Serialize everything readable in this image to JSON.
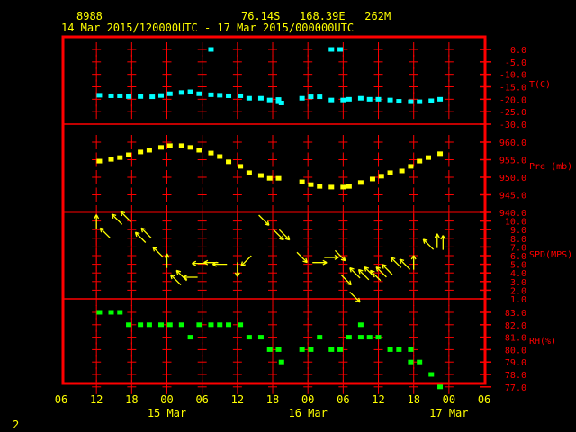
{
  "header": {
    "station": "8988",
    "location": "76.14S   168.39E   262M",
    "period": "14 Mar 2015/120000UTC - 17 Mar 2015/000000UTC",
    "page_number": "2"
  },
  "colors": {
    "frame": "#ff0000",
    "text": "#ffff00",
    "temperature": "#00ffff",
    "pressure": "#ffff00",
    "wind": "#ffff00",
    "rh": "#00ff00"
  },
  "chart_data": {
    "type": "scatter",
    "x_axis": {
      "range": [
        "14 Mar 06:00",
        "17 Mar 06:00"
      ],
      "tick_labels": [
        "06",
        "12",
        "18",
        "00",
        "06",
        "12",
        "18",
        "00",
        "06",
        "12",
        "18",
        "00",
        "06"
      ],
      "date_labels": [
        {
          "label": "15 Mar",
          "at": "15 Mar 00:00"
        },
        {
          "label": "16 Mar",
          "at": "16 Mar 00:00"
        },
        {
          "label": "17 Mar",
          "at": "17 Mar 00:00"
        }
      ]
    },
    "panels": [
      {
        "id": "temperature",
        "ylabel": "T(C)",
        "ylim": [
          -30,
          0
        ],
        "tick_labels": [
          "0.0",
          "-5.0",
          "-10.0",
          "-15.0",
          "-20.0",
          "-25.0",
          "-30.0"
        ],
        "points": [
          [
            "14 Mar 12:30",
            -18.4
          ],
          [
            "14 Mar 14:30",
            -18.6
          ],
          [
            "14 Mar 16:00",
            -18.6
          ],
          [
            "14 Mar 17:30",
            -18.9
          ],
          [
            "14 Mar 19:30",
            -18.9
          ],
          [
            "14 Mar 21:30",
            -19.0
          ],
          [
            "14 Mar 23:00",
            -18.5
          ],
          [
            "15 Mar 00:30",
            -17.8
          ],
          [
            "15 Mar 02:30",
            -17.3
          ],
          [
            "15 Mar 04:00",
            -17.0
          ],
          [
            "15 Mar 05:30",
            -17.8
          ],
          [
            "15 Mar 07:30",
            -18.2
          ],
          [
            "15 Mar 09:00",
            -18.4
          ],
          [
            "15 Mar 10:30",
            -18.6
          ],
          [
            "15 Mar 12:30",
            -18.6
          ],
          [
            "15 Mar 14:00",
            -19.6
          ],
          [
            "15 Mar 16:00",
            -19.6
          ],
          [
            "15 Mar 17:30",
            -20.3
          ],
          [
            "15 Mar 19:00",
            -20.1
          ],
          [
            "15 Mar 19:00",
            -21.0
          ],
          [
            "15 Mar 19:30",
            -21.5
          ],
          [
            "15 Mar 23:00",
            -19.6
          ],
          [
            "16 Mar 00:30",
            -19.0
          ],
          [
            "16 Mar 02:00",
            -19.0
          ],
          [
            "16 Mar 04:00",
            -20.3
          ],
          [
            "16 Mar 06:00",
            -20.3
          ],
          [
            "16 Mar 07:00",
            -20.0
          ],
          [
            "16 Mar 09:00",
            -19.6
          ],
          [
            "16 Mar 10:30",
            -20.0
          ],
          [
            "16 Mar 12:00",
            -20.0
          ],
          [
            "16 Mar 14:00",
            -20.3
          ],
          [
            "16 Mar 15:30",
            -20.8
          ],
          [
            "16 Mar 17:30",
            -21.0
          ],
          [
            "16 Mar 19:00",
            -21.0
          ],
          [
            "16 Mar 21:00",
            -20.6
          ],
          [
            "16 Mar 22:30",
            -20.0
          ],
          [
            "15 Mar 07:30",
            0.0
          ],
          [
            "16 Mar 04:00",
            0.0
          ],
          [
            "16 Mar 05:30",
            0.0
          ]
        ]
      },
      {
        "id": "pressure",
        "ylabel": "Pre (mb)",
        "ylim": [
          940,
          965
        ],
        "tick_labels": [
          "960.0",
          "955.0",
          "950.0",
          "945.0",
          "940.0"
        ],
        "points": [
          [
            "14 Mar 12:30",
            954.6
          ],
          [
            "14 Mar 14:30",
            955.1
          ],
          [
            "14 Mar 16:00",
            955.6
          ],
          [
            "14 Mar 17:30",
            956.4
          ],
          [
            "14 Mar 19:30",
            957.2
          ],
          [
            "14 Mar 21:00",
            957.7
          ],
          [
            "14 Mar 23:00",
            958.5
          ],
          [
            "15 Mar 00:30",
            959.0
          ],
          [
            "15 Mar 02:30",
            959.0
          ],
          [
            "15 Mar 04:00",
            958.5
          ],
          [
            "15 Mar 05:30",
            957.7
          ],
          [
            "15 Mar 07:30",
            956.9
          ],
          [
            "15 Mar 09:00",
            955.9
          ],
          [
            "15 Mar 10:30",
            954.4
          ],
          [
            "15 Mar 12:30",
            953.1
          ],
          [
            "15 Mar 14:00",
            951.3
          ],
          [
            "15 Mar 16:00",
            950.5
          ],
          [
            "15 Mar 17:30",
            949.7
          ],
          [
            "15 Mar 19:00",
            949.7
          ],
          [
            "15 Mar 23:00",
            948.7
          ],
          [
            "16 Mar 00:30",
            947.9
          ],
          [
            "16 Mar 02:00",
            947.4
          ],
          [
            "16 Mar 04:00",
            947.2
          ],
          [
            "16 Mar 06:00",
            947.2
          ],
          [
            "16 Mar 07:00",
            947.4
          ],
          [
            "16 Mar 09:00",
            948.5
          ],
          [
            "16 Mar 11:00",
            949.5
          ],
          [
            "16 Mar 12:30",
            950.3
          ],
          [
            "16 Mar 14:00",
            951.3
          ],
          [
            "16 Mar 16:00",
            951.8
          ],
          [
            "16 Mar 17:30",
            953.1
          ],
          [
            "16 Mar 19:00",
            954.6
          ],
          [
            "16 Mar 20:30",
            955.6
          ],
          [
            "16 Mar 22:30",
            956.7
          ]
        ]
      },
      {
        "id": "wind",
        "ylabel": "SPD(MPS)",
        "ylim": [
          1,
          10
        ],
        "tick_labels": [
          "10.0",
          "9.0",
          "8.0",
          "7.0",
          "6.0",
          "5.0",
          "4.0",
          "3.0",
          "2.0",
          "1.0"
        ],
        "points_note_fields": [
          "time",
          "speed",
          "direction_to_deg"
        ],
        "points": [
          [
            "14 Mar 12:00",
            9.9,
            0
          ],
          [
            "14 Mar 13:30",
            8.6,
            315
          ],
          [
            "14 Mar 15:30",
            10.2,
            315
          ],
          [
            "14 Mar 17:00",
            10.5,
            315
          ],
          [
            "14 Mar 19:30",
            8.1,
            315
          ],
          [
            "14 Mar 20:30",
            8.6,
            315
          ],
          [
            "14 Mar 22:30",
            6.4,
            315
          ],
          [
            "15 Mar 00:00",
            5.4,
            0
          ],
          [
            "15 Mar 01:30",
            3.2,
            315
          ],
          [
            "15 Mar 02:30",
            3.7,
            315
          ],
          [
            "15 Mar 04:00",
            3.5,
            270
          ],
          [
            "15 Mar 05:30",
            5.1,
            270
          ],
          [
            "15 Mar 07:30",
            5.2,
            270
          ],
          [
            "15 Mar 09:00",
            5.0,
            270
          ],
          [
            "15 Mar 12:00",
            4.4,
            180
          ],
          [
            "15 Mar 13:30",
            5.4,
            225
          ],
          [
            "15 Mar 16:30",
            10.1,
            135
          ],
          [
            "15 Mar 19:00",
            8.4,
            135
          ],
          [
            "15 Mar 20:00",
            8.4,
            135
          ],
          [
            "15 Mar 23:00",
            5.8,
            135
          ],
          [
            "16 Mar 02:00",
            5.2,
            90
          ],
          [
            "16 Mar 04:00",
            5.8,
            90
          ],
          [
            "16 Mar 05:30",
            6.0,
            135
          ],
          [
            "16 Mar 06:30",
            3.2,
            135
          ],
          [
            "16 Mar 08:00",
            1.2,
            135
          ],
          [
            "16 Mar 08:00",
            4.0,
            315
          ],
          [
            "16 Mar 09:30",
            3.8,
            315
          ],
          [
            "16 Mar 10:30",
            4.1,
            315
          ],
          [
            "16 Mar 11:30",
            3.7,
            315
          ],
          [
            "16 Mar 12:30",
            4.1,
            315
          ],
          [
            "16 Mar 13:30",
            4.4,
            315
          ],
          [
            "16 Mar 15:00",
            5.2,
            315
          ],
          [
            "16 Mar 16:30",
            5.0,
            315
          ],
          [
            "16 Mar 18:00",
            5.2,
            0
          ],
          [
            "16 Mar 20:30",
            7.3,
            315
          ],
          [
            "16 Mar 22:00",
            7.7,
            0
          ],
          [
            "16 Mar 23:00",
            7.5,
            0
          ]
        ]
      },
      {
        "id": "rh",
        "ylabel": "RH(%)",
        "ylim": [
          77,
          83
        ],
        "tick_labels": [
          "83.0",
          "82.0",
          "81.0",
          "80.0",
          "79.0",
          "78.0",
          "77.0"
        ],
        "points": [
          [
            "14 Mar 12:30",
            83
          ],
          [
            "14 Mar 14:30",
            83
          ],
          [
            "14 Mar 16:00",
            83
          ],
          [
            "14 Mar 17:30",
            82
          ],
          [
            "14 Mar 19:30",
            82
          ],
          [
            "14 Mar 21:00",
            82
          ],
          [
            "14 Mar 23:00",
            82
          ],
          [
            "15 Mar 00:30",
            82
          ],
          [
            "15 Mar 02:30",
            82
          ],
          [
            "15 Mar 04:00",
            81
          ],
          [
            "15 Mar 05:30",
            82
          ],
          [
            "15 Mar 07:30",
            82
          ],
          [
            "15 Mar 09:00",
            82
          ],
          [
            "15 Mar 10:30",
            82
          ],
          [
            "15 Mar 12:30",
            82
          ],
          [
            "15 Mar 14:00",
            81
          ],
          [
            "15 Mar 16:00",
            81
          ],
          [
            "15 Mar 17:30",
            80
          ],
          [
            "15 Mar 19:00",
            80
          ],
          [
            "15 Mar 19:30",
            79
          ],
          [
            "15 Mar 23:00",
            80
          ],
          [
            "16 Mar 00:30",
            80
          ],
          [
            "16 Mar 02:00",
            81
          ],
          [
            "16 Mar 04:00",
            80
          ],
          [
            "16 Mar 05:30",
            80
          ],
          [
            "16 Mar 07:00",
            81
          ],
          [
            "16 Mar 09:00",
            82
          ],
          [
            "16 Mar 09:00",
            81
          ],
          [
            "16 Mar 10:30",
            81
          ],
          [
            "16 Mar 12:00",
            81
          ],
          [
            "16 Mar 14:00",
            80
          ],
          [
            "16 Mar 15:30",
            80
          ],
          [
            "16 Mar 17:30",
            80
          ],
          [
            "16 Mar 17:30",
            79
          ],
          [
            "16 Mar 19:00",
            79
          ],
          [
            "16 Mar 21:00",
            78
          ],
          [
            "16 Mar 22:30",
            77
          ]
        ]
      }
    ]
  }
}
